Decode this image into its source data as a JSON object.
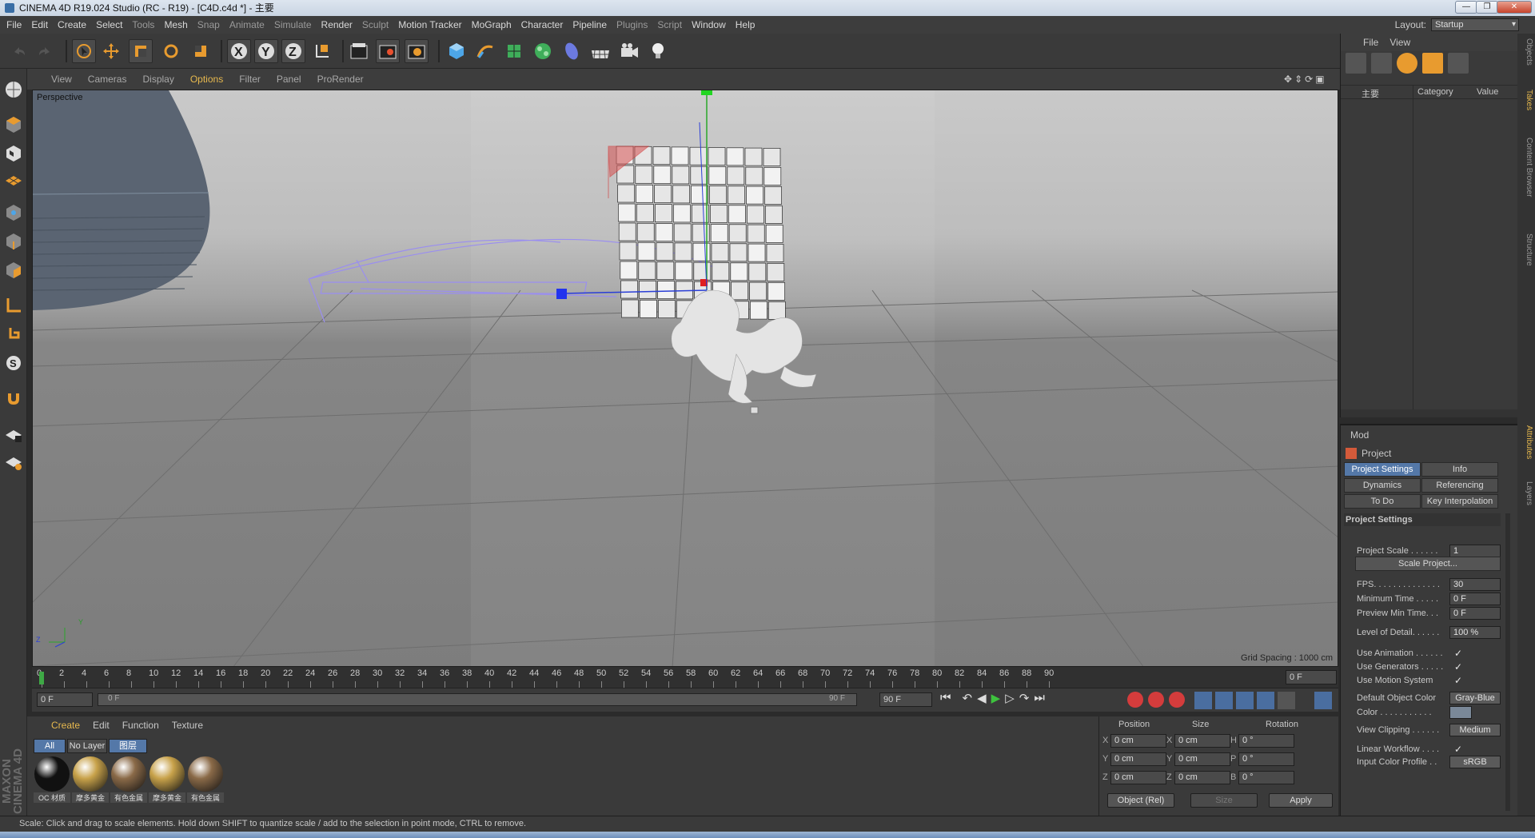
{
  "window": {
    "title": "CINEMA 4D R19.024 Studio (RC - R19) - [C4D.c4d *] - 主要",
    "minimize": "—",
    "maximize": "❐",
    "close": "✕"
  },
  "menu": [
    "File",
    "Edit",
    "Create",
    "Select",
    "Tools",
    "Mesh",
    "Snap",
    "Animate",
    "Simulate",
    "Render",
    "Sculpt",
    "Motion Tracker",
    "MoGraph",
    "Character",
    "Pipeline",
    "Plugins",
    "Script",
    "Window",
    "Help"
  ],
  "layout": {
    "label": "Layout:",
    "value": "Startup"
  },
  "viewport": {
    "menu": [
      "View",
      "Cameras",
      "Display",
      "Options",
      "Filter",
      "Panel",
      "ProRender"
    ],
    "active_menu": "Options",
    "camera": "Perspective",
    "grid_spacing": "Grid Spacing : 1000 cm",
    "axis_y": "Y",
    "axis_z": "Z"
  },
  "timeline": {
    "ticks": [
      "0",
      "2",
      "4",
      "6",
      "8",
      "10",
      "12",
      "14",
      "16",
      "18",
      "20",
      "22",
      "24",
      "26",
      "28",
      "30",
      "32",
      "34",
      "36",
      "38",
      "40",
      "42",
      "44",
      "46",
      "48",
      "50",
      "52",
      "54",
      "56",
      "58",
      "60",
      "62",
      "64",
      "66",
      "68",
      "70",
      "72",
      "74",
      "76",
      "78",
      "80",
      "82",
      "84",
      "86",
      "88",
      "90"
    ],
    "current_frame": "0 F",
    "start_field": "0 F",
    "range_start": "0 F",
    "range_end": "90 F",
    "end_field": "90 F"
  },
  "materials": {
    "menu": [
      "Create",
      "Edit",
      "Function",
      "Texture"
    ],
    "active_menu": "Create",
    "filters": [
      "All",
      "No Layer",
      "图层"
    ],
    "items": [
      {
        "name": "OC 材质",
        "color": "#111111"
      },
      {
        "name": "摩多黄金",
        "color": "#c8a24a"
      },
      {
        "name": "有色金属",
        "color": "#8a6a48"
      },
      {
        "name": "摩多黄金",
        "color": "#c8a24a"
      },
      {
        "name": "有色金属",
        "color": "#8a6a48"
      }
    ],
    "brand": "MAXON CINEMA 4D"
  },
  "coordinates": {
    "headers": [
      "Position",
      "Size",
      "Rotation"
    ],
    "rows": [
      {
        "a": "X",
        "pos": "0 cm",
        "b": "X",
        "size": "0 cm",
        "c": "H",
        "rot": "0 °"
      },
      {
        "a": "Y",
        "pos": "0 cm",
        "b": "Y",
        "size": "0 cm",
        "c": "P",
        "rot": "0 °"
      },
      {
        "a": "Z",
        "pos": "0 cm",
        "b": "Z",
        "size": "0 cm",
        "c": "B",
        "rot": "0 °"
      }
    ],
    "mode": "Object (Rel)",
    "size_mode": "Size",
    "apply": "Apply"
  },
  "objects": {
    "menu": [
      "File",
      "View"
    ],
    "columns": [
      "主要",
      "Category",
      "Value"
    ]
  },
  "attributes": {
    "mode": "Mod",
    "title": "Project",
    "tabs": [
      "Project Settings",
      "Info",
      "Dynamics",
      "Referencing",
      "To Do",
      "Key Interpolation"
    ],
    "section": "Project Settings",
    "props": [
      {
        "label": "Project Scale . . . . . .",
        "value": "1"
      },
      {
        "label": "FPS. . . . . . . . . . . . . .",
        "value": "30"
      },
      {
        "label": "Minimum Time . . . . .",
        "value": "0 F"
      },
      {
        "label": "Preview Min Time. . .",
        "value": "0 F"
      },
      {
        "label": "Level of Detail. . . . . .",
        "value": "100 %"
      },
      {
        "label": "Use Animation . . . . . .",
        "check": "✓"
      },
      {
        "label": "Use Generators . . . . .",
        "check": "✓"
      },
      {
        "label": "Use Motion System",
        "check": "✓"
      },
      {
        "label": "Default Object Color",
        "value": "Gray-Blue"
      },
      {
        "label": "Color  . . . . . . . . . . .",
        "value": ""
      },
      {
        "label": "View Clipping . . . . . .",
        "value": "Medium"
      },
      {
        "label": "Linear Workflow . . . .",
        "check": "✓"
      },
      {
        "label": "Input Color Profile . .",
        "value": "sRGB"
      }
    ],
    "scale_button": "Scale Project..."
  },
  "side_tabs": [
    "Objects",
    "Takes",
    "Content Browser",
    "Structure",
    "Attributes",
    "Layers"
  ],
  "status": "Scale: Click and drag to scale elements. Hold down SHIFT to quantize scale / add to the selection in point mode, CTRL to remove."
}
